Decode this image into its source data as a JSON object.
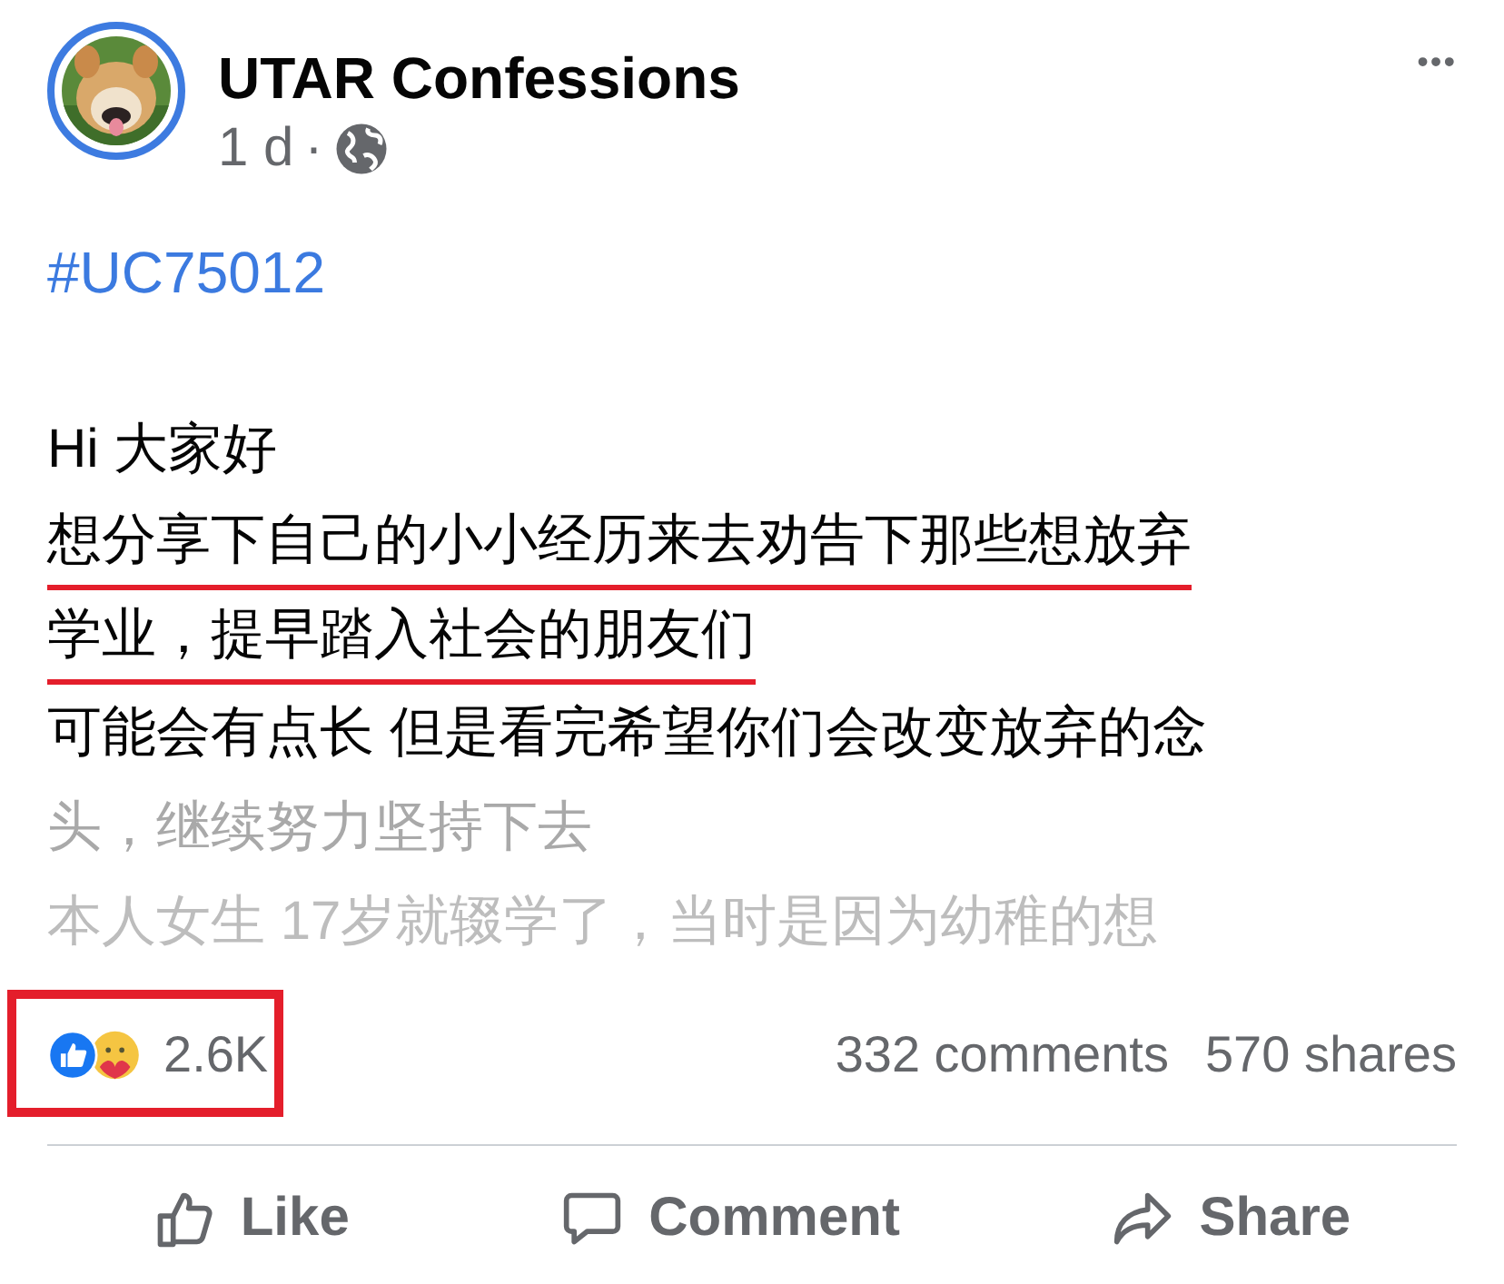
{
  "post": {
    "author": "UTAR Confessions",
    "time": "1 d",
    "separator": "·",
    "more": "•••",
    "hashtag": "#UC75012",
    "lines": [
      {
        "text": "Hi 大家好",
        "kind": "normal"
      },
      {
        "text": "想分享下自己的小小经历来去劝告下那些想放弃",
        "kind": "underlined"
      },
      {
        "text": "学业，提早踏入社会的朋友们",
        "kind": "underlined"
      },
      {
        "text": "可能会有点长 但是看完希望你们会改变放弃的念",
        "kind": "normal"
      },
      {
        "text": "头，继续努力坚持下去",
        "kind": "faded"
      },
      {
        "text": "本人女生 17岁就辍学了，当时是因为幼稚的想",
        "kind": "ghost"
      }
    ]
  },
  "stats": {
    "reactions": "2.6K",
    "highlighted": true,
    "comments": "332 comments",
    "shares": "570 shares"
  },
  "actions": [
    {
      "label": "Like",
      "kind": "like"
    },
    {
      "label": "Comment",
      "kind": "comment"
    },
    {
      "label": "Share",
      "kind": "share"
    }
  ]
}
